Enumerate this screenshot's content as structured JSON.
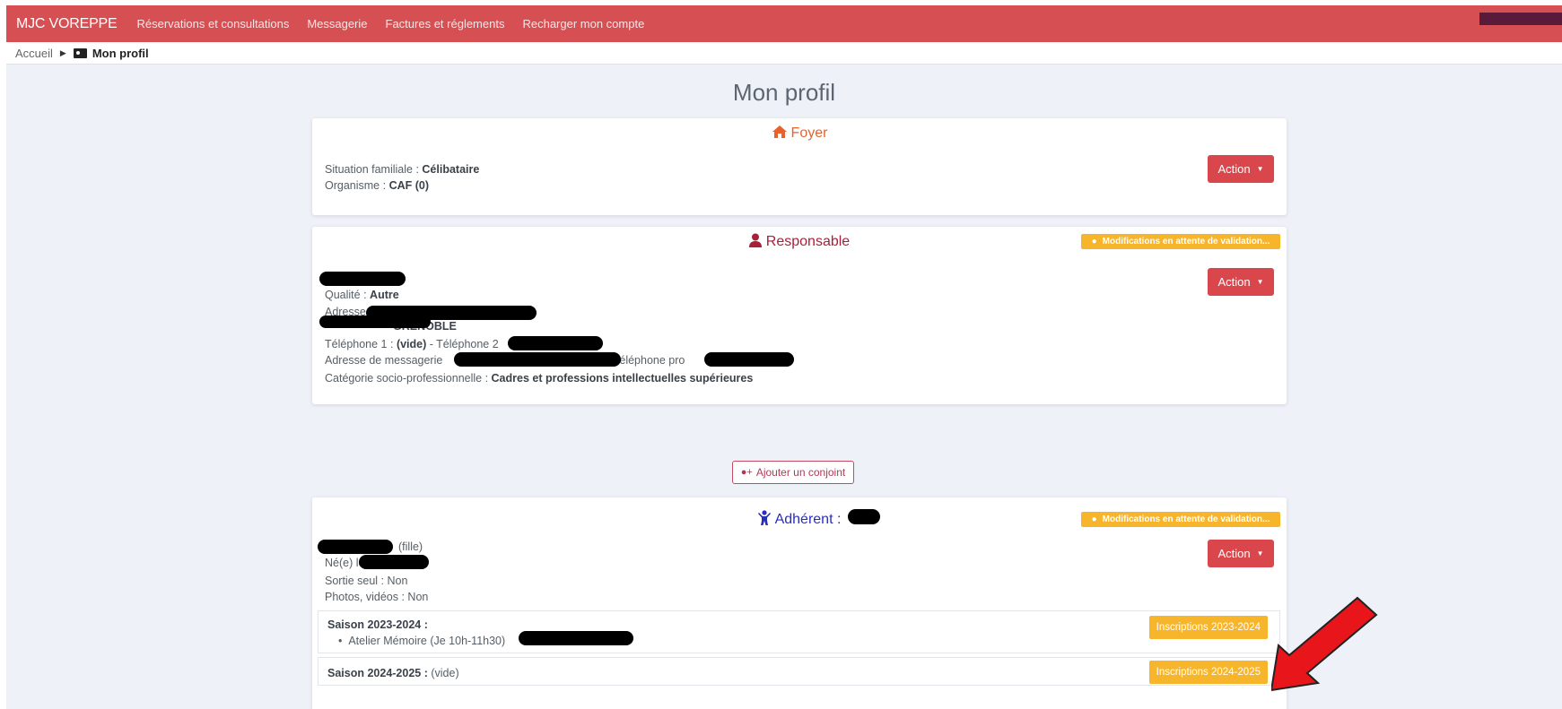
{
  "navbar": {
    "brand": "MJC VOREPPE",
    "links": [
      "Réservations et consultations",
      "Messagerie",
      "Factures et réglements",
      "Recharger mon compte"
    ]
  },
  "breadcrumb": {
    "home": "Accueil",
    "current": "Mon profil"
  },
  "page_title": "Mon profil",
  "foyer": {
    "title": "Foyer",
    "situation_label": "Situation familiale :",
    "situation_value": "Célibataire",
    "organisme_label": "Organisme :",
    "organisme_value": "CAF (0)",
    "action_label": "Action"
  },
  "responsable": {
    "title": "Responsable",
    "pending_label": "Modifications en attente de validation...",
    "qualite_label": "Qualité :",
    "qualite_value": "Autre",
    "adresse_label": "Adresse",
    "city_partial": "GRENOBLE",
    "tel1_label": "Téléphone 1 :",
    "tel1_value": "(vide)",
    "tel2_label": "- Téléphone 2",
    "email_label": "Adresse de messagerie",
    "telpro_label": "- Téléphone pro",
    "csp_label": "Catégorie socio-professionnelle :",
    "csp_value": "Cadres et professions intellectuelles supérieures",
    "action_label": "Action"
  },
  "add_conjoint_label": "Ajouter un conjoint",
  "adherent": {
    "title": "Adhérent :",
    "pending_label": "Modifications en attente de validation...",
    "relation": "(fille)",
    "born_label": "Né(e) le",
    "sortie": "Sortie seul : Non",
    "photos": "Photos, vidéos : Non",
    "action_label": "Action",
    "seasons": [
      {
        "label": "Saison 2023-2024 :",
        "value": "",
        "item": "Atelier Mémoire (Je 10h-11h30)",
        "button": "Inscriptions 2023-2024"
      },
      {
        "label": "Saison 2024-2025 :",
        "value": "(vide)",
        "item": "",
        "button": "Inscriptions 2024-2025"
      }
    ]
  },
  "colors": {
    "navbar": "#d64f53",
    "foyer_title": "#e8622c",
    "responsable_title": "#a8203a",
    "adherent_title": "#2a2fb8",
    "action_button": "#d9474d",
    "badge": "#f7b52c",
    "arrow": "#e8161a"
  }
}
